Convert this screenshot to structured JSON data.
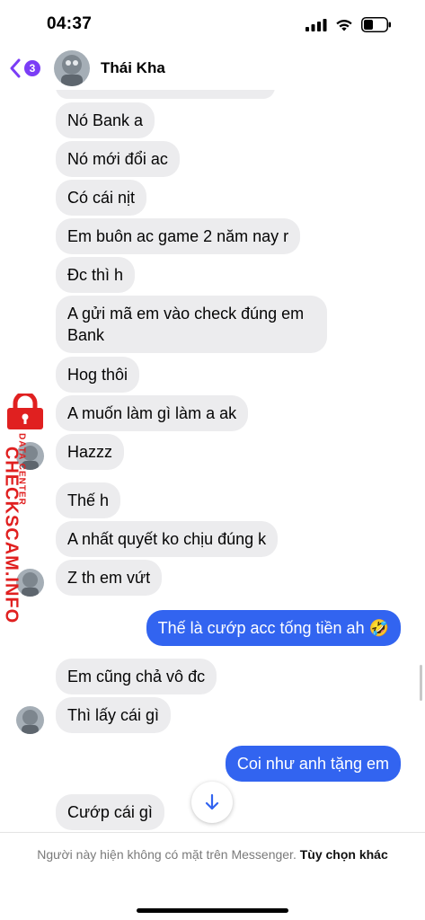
{
  "status_bar": {
    "time": "04:37"
  },
  "header": {
    "unread_count": "3",
    "contact_name": "Thái Kha"
  },
  "messages": [
    {
      "text": "Nó Bank a"
    },
    {
      "text": "Nó mới đổi ac"
    },
    {
      "text": "Có cái nịt"
    },
    {
      "text": "Em buôn ac game 2 năm nay r"
    },
    {
      "text": "Đc thì h"
    },
    {
      "text": "A gửi mã em vào check đúng em Bank"
    },
    {
      "text": "Hog thôi"
    },
    {
      "text": "A muốn làm gì làm a ak"
    },
    {
      "text": "Hazzz"
    },
    {
      "text": "Thế h"
    },
    {
      "text": "A nhất quyết ko chịu đúng k"
    },
    {
      "text": "Z th em vứt"
    },
    {
      "text": "Thế là cướp acc tống tiền ah 🤣"
    },
    {
      "text": "Em cũng chả vô đc"
    },
    {
      "text": "Thì lấy cái gì"
    },
    {
      "text": "Coi như anh tặng em"
    },
    {
      "text": "Cướp cái gì"
    }
  ],
  "watermark": {
    "brand": "CHECKSCAM.INFO",
    "sub": "DATA CENTER"
  },
  "footer": {
    "notice": "Người này hiện không có mặt trên Messenger.",
    "link": "Tùy chọn khác"
  },
  "colors": {
    "accent": "#3264f0",
    "incoming_bubble": "#ececee",
    "badge": "#7b3df6",
    "watermark": "#e02020"
  }
}
